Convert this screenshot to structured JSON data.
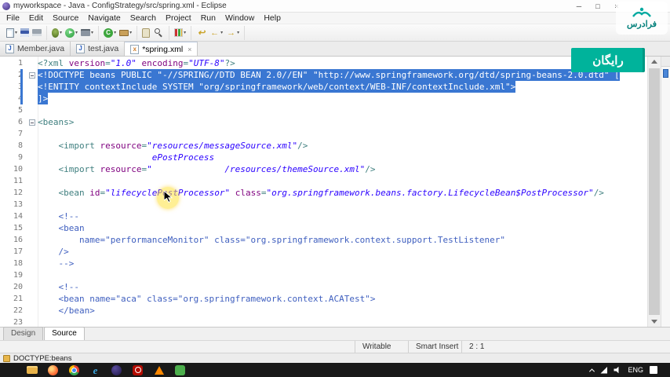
{
  "window": {
    "title": "myworkspace - Java - ConfigStrategy/src/spring.xml - Eclipse",
    "controls": {
      "minimize": "─",
      "maximize": "□",
      "close": "×"
    }
  },
  "icons": {
    "dropdown": "▾",
    "tab_close": "×"
  },
  "menu": {
    "items": [
      "File",
      "Edit",
      "Source",
      "Navigate",
      "Search",
      "Project",
      "Run",
      "Window",
      "Help"
    ]
  },
  "toolbar": {
    "groups": [
      {
        "items": [
          {
            "name": "new-wizard-icon",
            "kind": "page",
            "caret": true
          },
          {
            "name": "save-icon",
            "kind": "floppy",
            "caret": false
          },
          {
            "name": "print-icon",
            "kind": "printer",
            "caret": false
          }
        ]
      },
      {
        "items": [
          {
            "name": "debug-icon",
            "kind": "bug",
            "caret": true
          },
          {
            "name": "run-icon",
            "kind": "run",
            "caret": true
          },
          {
            "name": "external-tools-icon",
            "kind": "tools",
            "caret": true
          }
        ]
      },
      {
        "items": [
          {
            "name": "new-java-class-icon",
            "kind": "class",
            "caret": true
          },
          {
            "name": "new-java-package-icon",
            "kind": "package",
            "caret": true
          }
        ]
      },
      {
        "items": [
          {
            "name": "open-jar-icon",
            "kind": "jar",
            "caret": false
          },
          {
            "name": "search-icon",
            "kind": "search",
            "caret": false
          }
        ]
      },
      {
        "items": [
          {
            "name": "coverage-icon",
            "kind": "coverage",
            "caret": true
          }
        ]
      },
      {
        "items": [
          {
            "name": "last-edit-location-icon",
            "kind": "lastedit",
            "caret": false
          },
          {
            "name": "back-icon",
            "kind": "back",
            "caret": true
          },
          {
            "name": "forward-icon",
            "kind": "forward",
            "caret": true
          }
        ]
      }
    ]
  },
  "tabs": [
    {
      "label": "Member.java",
      "icon": "java",
      "active": false
    },
    {
      "label": "test.java",
      "icon": "java",
      "active": false
    },
    {
      "label": "*spring.xml",
      "icon": "xml",
      "active": true
    }
  ],
  "editor": {
    "token_colors": {
      "tag": "#3f7f7f",
      "attr": "#7f007f",
      "value": "#2a00ff",
      "comment": "#3f5fbf",
      "plain": "#000000",
      "selection_bg": "#3a77d2",
      "selection_fg": "#ffffff",
      "line_number": "#787878"
    },
    "lines": [
      {
        "n": 1,
        "seg": [
          [
            "t",
            "<?xml "
          ],
          [
            "a",
            "version"
          ],
          [
            "t",
            "="
          ],
          [
            "v",
            "\"1.0\""
          ],
          [
            "t",
            " "
          ],
          [
            "a",
            "encoding"
          ],
          [
            "t",
            "="
          ],
          [
            "v",
            "\"UTF-8\""
          ],
          [
            "t",
            "?>"
          ]
        ]
      },
      {
        "n": 2,
        "sel": true,
        "bar": true,
        "fold": true,
        "seg": [
          [
            "p",
            "<!DOCTYPE beans PUBLIC \"-//SPRING//DTD BEAN 2.0//EN\" \"http://www.springframework.org/dtd/spring-beans-2.0.dtd\" ["
          ]
        ]
      },
      {
        "n": 3,
        "sel": true,
        "bar": true,
        "seg": [
          [
            "p",
            "<!ENTITY contextInclude SYSTEM \"org/springframework/web/context/WEB-INF/contextInclude.xml\">"
          ]
        ]
      },
      {
        "n": 4,
        "sel": true,
        "bar": true,
        "seg": [
          [
            "p",
            "]>"
          ]
        ]
      },
      {
        "n": 5,
        "seg": []
      },
      {
        "n": 6,
        "fold": true,
        "seg": [
          [
            "t",
            "<beans>"
          ]
        ]
      },
      {
        "n": 7,
        "seg": []
      },
      {
        "n": 8,
        "seg": [
          [
            "p",
            "    "
          ],
          [
            "t",
            "<import "
          ],
          [
            "a",
            "resource"
          ],
          [
            "t",
            "="
          ],
          [
            "v",
            "\"resources/messageSource.xml\""
          ],
          [
            "t",
            "/>"
          ]
        ]
      },
      {
        "n": 9,
        "seg": [
          [
            "g",
            "                      ePostProcess"
          ]
        ]
      },
      {
        "n": 10,
        "seg": [
          [
            "p",
            "    "
          ],
          [
            "t",
            "<import "
          ],
          [
            "a",
            "resource"
          ],
          [
            "t",
            "="
          ],
          [
            "v",
            "\"              /resources/themeSource.xml\""
          ],
          [
            "t",
            "/>"
          ]
        ]
      },
      {
        "n": 11,
        "seg": []
      },
      {
        "n": 12,
        "seg": [
          [
            "p",
            "    "
          ],
          [
            "t",
            "<bean "
          ],
          [
            "a",
            "id"
          ],
          [
            "t",
            "="
          ],
          [
            "v",
            "\"lifecyclePostProcessor\""
          ],
          [
            "t",
            " "
          ],
          [
            "a",
            "class"
          ],
          [
            "t",
            "="
          ],
          [
            "v",
            "\"org.springframework.beans.factory.LifecycleBean$PostProcessor\""
          ],
          [
            "t",
            "/>"
          ]
        ]
      },
      {
        "n": 13,
        "seg": []
      },
      {
        "n": 14,
        "seg": [
          [
            "c",
            "    <!--"
          ]
        ]
      },
      {
        "n": 15,
        "seg": [
          [
            "c",
            "    <bean"
          ]
        ]
      },
      {
        "n": 16,
        "seg": [
          [
            "c",
            "        name=\"performanceMonitor\" class=\"org.springframework.context.support.TestListener\""
          ]
        ]
      },
      {
        "n": 17,
        "seg": [
          [
            "c",
            "    />"
          ]
        ]
      },
      {
        "n": 18,
        "seg": [
          [
            "c",
            "    -->"
          ]
        ]
      },
      {
        "n": 19,
        "seg": []
      },
      {
        "n": 20,
        "seg": [
          [
            "c",
            "    <!--"
          ]
        ]
      },
      {
        "n": 21,
        "seg": [
          [
            "c",
            "    <bean name=\"aca\" class=\"org.springframework.context.ACATest\">"
          ]
        ]
      },
      {
        "n": 22,
        "seg": [
          [
            "c",
            "    </bean>"
          ]
        ]
      },
      {
        "n": 23,
        "seg": []
      }
    ]
  },
  "page_tabs": {
    "design": "Design",
    "source": "Source"
  },
  "status_bar": {
    "writable": "Writable",
    "insert_mode": "Smart Insert",
    "caret_position": "2 : 1"
  },
  "breadcrumb": {
    "label": "DOCTYPE:beans"
  },
  "watermark": {
    "brand": "فرادرس",
    "badge": "رایگان",
    "accent": "#00b39b"
  },
  "taskbar": {
    "items": [
      {
        "name": "start-button",
        "kind": "start"
      },
      {
        "name": "file-explorer",
        "kind": "folder"
      },
      {
        "name": "firefox",
        "kind": "firefox"
      },
      {
        "name": "chrome",
        "kind": "chrome"
      },
      {
        "name": "edge",
        "kind": "edge"
      },
      {
        "name": "eclipse",
        "kind": "eclipse"
      },
      {
        "name": "acrobat-reader",
        "kind": "acrobat"
      },
      {
        "name": "vlc",
        "kind": "vlc"
      },
      {
        "name": "notepad",
        "kind": "green"
      }
    ],
    "tray": {
      "language": "ENG"
    }
  }
}
